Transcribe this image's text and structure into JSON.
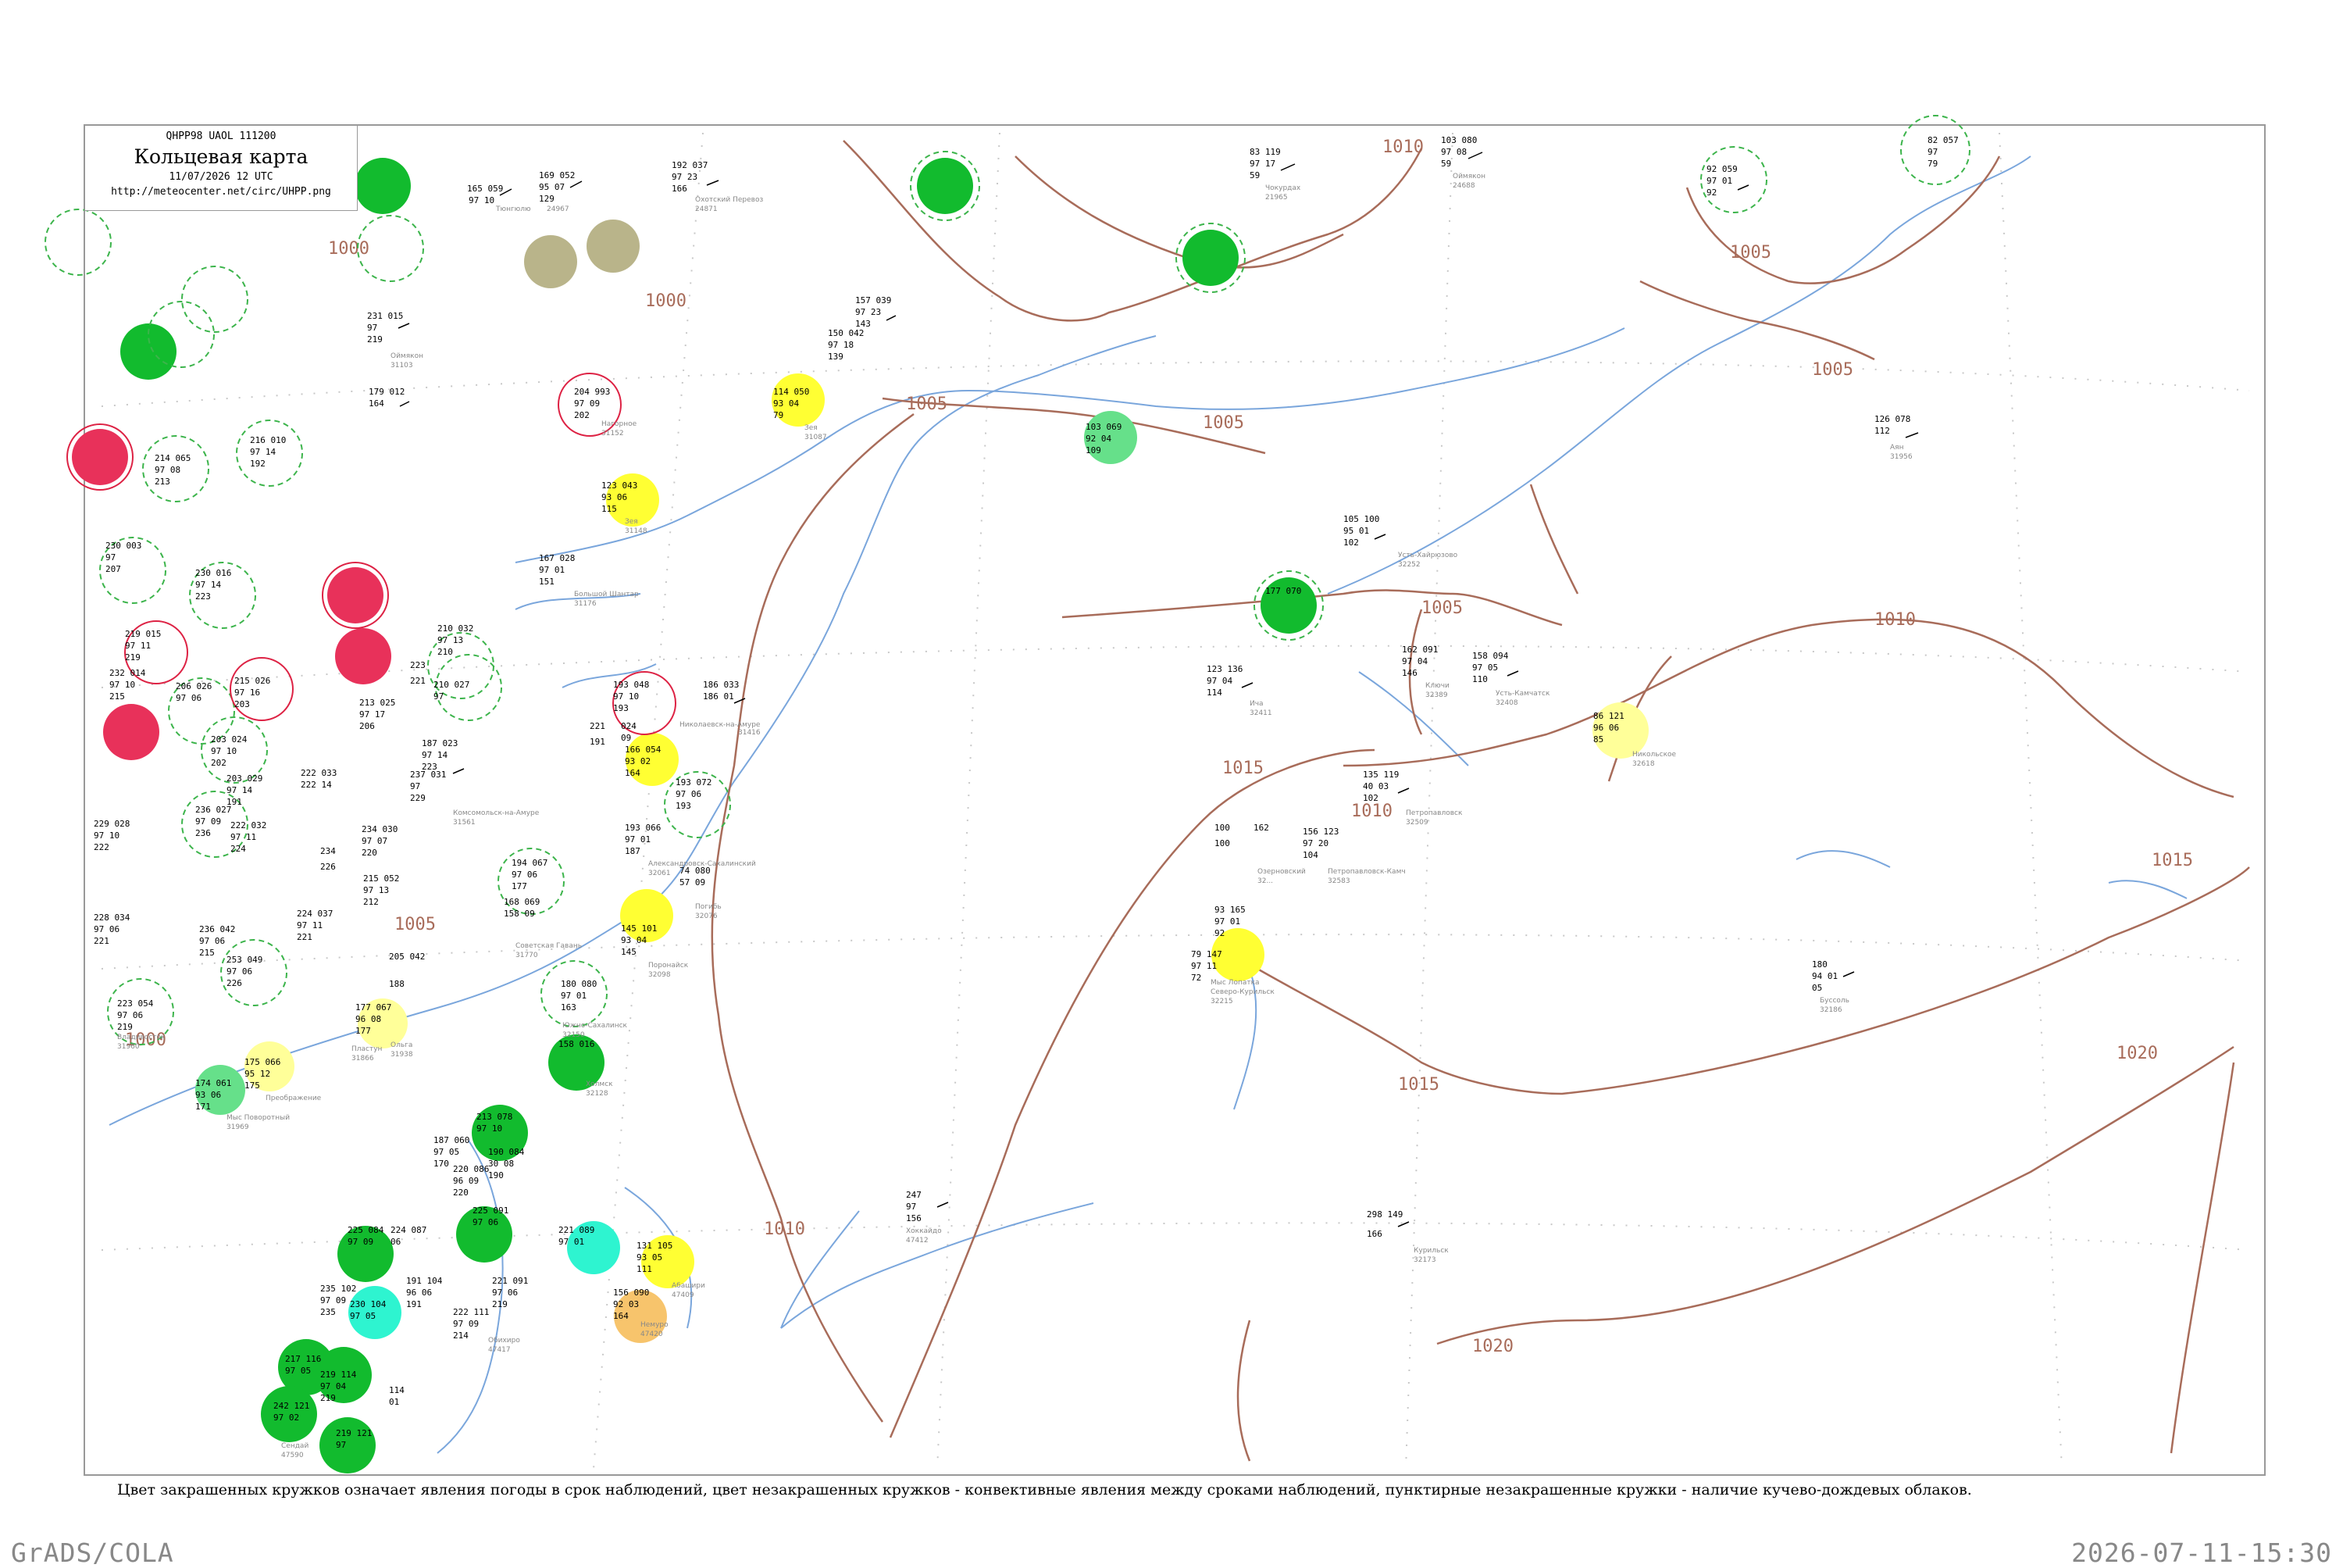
{
  "header": {
    "code": "QHPP98 UAOL 111200",
    "title": "Кольцевая карта",
    "datetime": "11/07/2026 12 UTC",
    "url": "http://meteocenter.net/circ/UHPP.png"
  },
  "isobars": {
    "labels": [
      "1000",
      "1005",
      "1010",
      "1015",
      "1020"
    ],
    "line_color": "#a86c5a"
  },
  "legend_text": "Цвет закрашенных кружков означает явления погоды в срок наблюдений, цвет незакрашенных кружков - конвективные явления между сроками наблюдений, пунктирные незакрашенные кружки - наличие кучево-дождевых облаков.",
  "footer": {
    "left": "GrADS/COLA",
    "right": "2026-07-11-15:30"
  },
  "colors": {
    "frame": "#999999",
    "coast": "#7aa6dc",
    "grid": "#c8c8c8",
    "dashed_circle": "#3cb44b",
    "outline_circle_red": "#dd2244",
    "green_fill": "#12bb2e",
    "light_green_fill": "#66e08a",
    "red_fill": "#e8315a",
    "yellow_fill": "#ffff33",
    "pale_yellow_fill": "#ffff99",
    "orange_fill": "#f7c46c",
    "cyan_fill": "#2ef4d0",
    "olive_fill": "#b9b48a"
  }
}
